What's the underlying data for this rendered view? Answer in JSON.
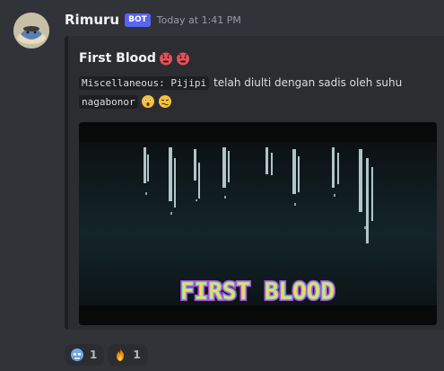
{
  "message": {
    "username": "Rimuru",
    "bot_badge": "BOT",
    "timestamp": "Today at 1:41 PM"
  },
  "embed": {
    "title": "First Blood",
    "title_emojis": [
      "rage-emoji",
      "rage-emoji"
    ],
    "desc_code_1": "Miscellaneous: Pijipi",
    "desc_text": "telah diulti dengan sadis oleh suhu",
    "desc_code_2": "nagabonor",
    "desc_emojis": [
      "astonished-emoji",
      "woozy-emoji"
    ],
    "image_text": "FIRST BLOOD"
  },
  "reactions": [
    {
      "emoji": "ice-cold-face-emoji",
      "count": "1"
    },
    {
      "emoji": "fire-emoji",
      "count": "1"
    }
  ],
  "colors": {
    "background": "#313338",
    "embed_background": "#2b2d31",
    "embed_border": "#1e1f22",
    "bot_badge": "#5865f2",
    "username": "#f2f3f5",
    "timestamp": "#949ba4",
    "image_text_fill": "#ffd84a",
    "image_text_outline": "#b04fd6"
  }
}
